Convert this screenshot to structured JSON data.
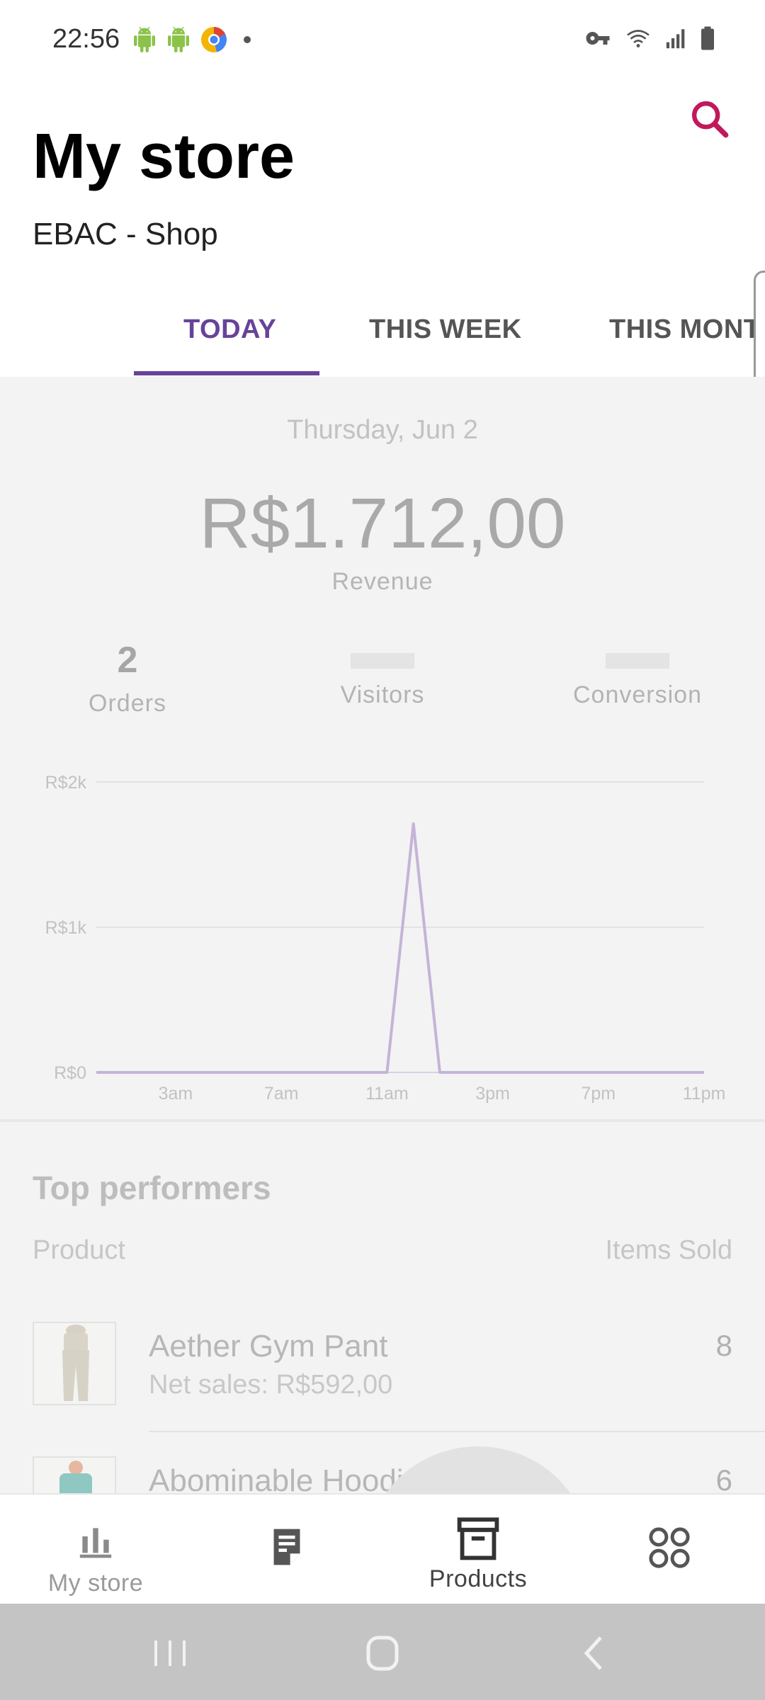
{
  "status_bar": {
    "time": "22:56",
    "left_icons": [
      "android-icon",
      "android-icon",
      "chrome-like-icon",
      "dot-icon"
    ],
    "right_icons": [
      "vpn-key-icon",
      "wifi-icon",
      "signal-icon",
      "battery-icon"
    ]
  },
  "header": {
    "title": "My store",
    "store_name": "EBAC - Shop",
    "search_icon": "search-icon",
    "accent_color": "#c2185b"
  },
  "tabs": [
    {
      "label": "TODAY",
      "active": true
    },
    {
      "label": "THIS WEEK",
      "active": false
    },
    {
      "label": "THIS MONTH",
      "active": false
    }
  ],
  "summary": {
    "date": "Thursday, Jun 2",
    "revenue": "R$1.712,00",
    "revenue_label": "Revenue",
    "stats": [
      {
        "value": "2",
        "label": "Orders"
      },
      {
        "value": "",
        "label": "Visitors"
      },
      {
        "value": "",
        "label": "Conversion"
      }
    ]
  },
  "chart_data": {
    "type": "line",
    "x": [
      "12am",
      "1am",
      "2am",
      "3am",
      "4am",
      "5am",
      "6am",
      "7am",
      "8am",
      "9am",
      "10am",
      "11am",
      "12pm",
      "1pm",
      "2pm",
      "3pm",
      "4pm",
      "5pm",
      "6pm",
      "7pm",
      "8pm",
      "9pm",
      "10pm",
      "11pm"
    ],
    "x_tick_labels": [
      "3am",
      "7am",
      "11am",
      "3pm",
      "7pm",
      "11pm"
    ],
    "series": [
      {
        "values": [
          0,
          0,
          0,
          0,
          0,
          0,
          0,
          0,
          0,
          0,
          0,
          0,
          1712,
          0,
          0,
          0,
          0,
          0,
          0,
          0,
          0,
          0,
          0,
          0
        ]
      }
    ],
    "y_tick_labels": [
      "R$2k",
      "R$1k",
      "R$0"
    ],
    "ylim": [
      0,
      2000
    ],
    "grid": true,
    "line_color": "#c4b4d8"
  },
  "top_performers": {
    "title": "Top performers",
    "col_product": "Product",
    "col_items": "Items Sold",
    "rows": [
      {
        "name": "Aether Gym Pant",
        "net_sales": "Net sales: R$592,00",
        "count": "8"
      },
      {
        "name": "Abominable Hoodie",
        "net_sales": "",
        "count": "6"
      }
    ]
  },
  "bottom_nav": [
    {
      "label": "My store",
      "icon": "bar-chart-icon"
    },
    {
      "label": "",
      "icon": "orders-icon"
    },
    {
      "label": "Products",
      "icon": "archive-box-icon"
    },
    {
      "label": "",
      "icon": "more-grid-icon"
    }
  ],
  "system_nav": [
    "recent-apps-icon",
    "home-icon",
    "back-icon"
  ]
}
